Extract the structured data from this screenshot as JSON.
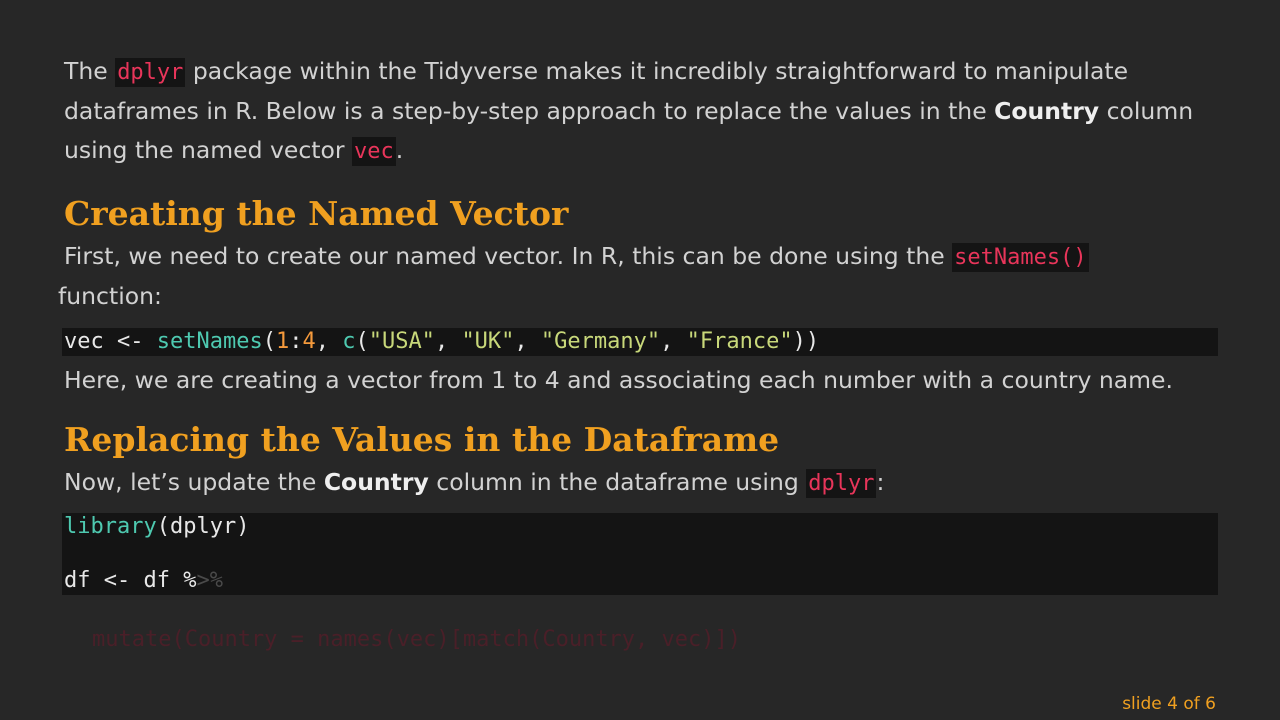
{
  "intro": {
    "t1": "The ",
    "code1": "dplyr",
    "t2": " package within the Tidyverse makes it incredibly straightforward to manipulate dataframes in R. Below is a step-by-step approach to replace the values in the ",
    "bold1": "Country",
    "t3": " column using the named vector ",
    "code2": "vec",
    "t4": "."
  },
  "section1": {
    "heading": "Creating the Named Vector",
    "p1_t1": "First, we need to create our named vector. In R, this can be done using the ",
    "p1_code": "setNames()",
    "p1_t2": " function:",
    "code": {
      "var": "vec",
      "assign": " <- ",
      "fn": "setNames",
      "open": "(",
      "n1": "1",
      "colon": ":",
      "n2": "4",
      "comma1": ", ",
      "c_fn": "c",
      "open2": "(",
      "s1": "\"USA\"",
      "comma2": ", ",
      "s2": "\"UK\"",
      "comma3": ", ",
      "s3": "\"Germany\"",
      "comma4": ", ",
      "s4": "\"France\"",
      "close": "))"
    },
    "p2": "Here, we are creating a vector from 1 to 4 and associating each number with a country name."
  },
  "section2": {
    "heading": "Replacing the Values in the Dataframe",
    "p1_t1": "Now, let’s update the ",
    "p1_bold": "Country",
    "p1_t2": " column in the dataframe using ",
    "p1_code": "dplyr",
    "p1_t3": ":",
    "code": {
      "l1_fn": "library",
      "l1_rest": "(dplyr)",
      "l3_a": "df <- df %",
      "l3_b": ">%"
    },
    "faded_line": "mutate(Country = names(vec)[match(Country, vec)])"
  },
  "footer": {
    "slide": "slide 4 of 6"
  }
}
